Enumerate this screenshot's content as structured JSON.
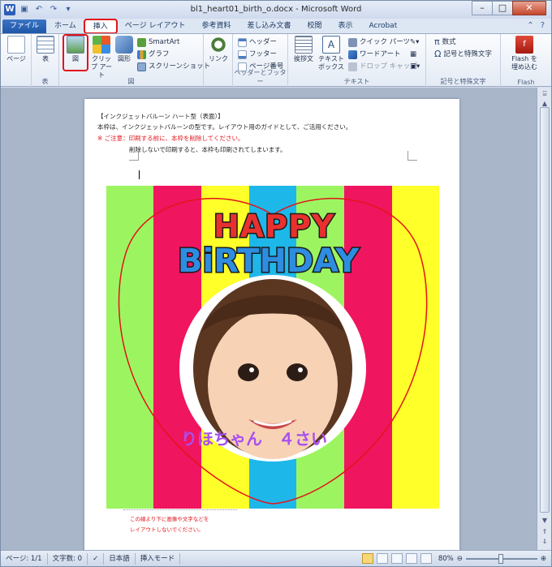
{
  "window": {
    "title": "bl1_heart01_birth_o.docx - Microsoft Word",
    "app_icon_letter": "W"
  },
  "quick_access": [
    "save-icon",
    "undo-icon",
    "redo-icon",
    "customize-icon"
  ],
  "tabs": [
    {
      "label": "ファイル"
    },
    {
      "label": "ホーム"
    },
    {
      "label": "挿入"
    },
    {
      "label": "ページ レイアウト"
    },
    {
      "label": "参考資料"
    },
    {
      "label": "差し込み文書"
    },
    {
      "label": "校閲"
    },
    {
      "label": "表示"
    },
    {
      "label": "Acrobat"
    }
  ],
  "ribbon": {
    "pages": {
      "label": "ページ"
    },
    "tables": {
      "button": "表",
      "group": "表"
    },
    "illustrations": {
      "picture": "図",
      "clipart": "クリップ アート",
      "shapes": "図形",
      "smartart": "SmartArt",
      "chart": "グラフ",
      "screenshot": "スクリーンショット",
      "group": "図"
    },
    "links": {
      "button": "リンク"
    },
    "header_footer": {
      "header": "ヘッダー",
      "footer": "フッター",
      "page_number": "ページ番号",
      "group": "ヘッダーとフッター"
    },
    "text": {
      "textbox": "挨拶文",
      "textbox2": "テキスト ボックス",
      "quickparts": "クイック パーツ",
      "wordart": "ワードアート",
      "dropcap": "ドロップ キャップ",
      "group": "テキスト"
    },
    "symbols": {
      "equation": "数式",
      "symbol": "記号と特殊文字",
      "group": "記号と特殊文字"
    },
    "flash": {
      "button_line1": "Flash を",
      "button_line2": "埋め込む",
      "group": "Flash"
    }
  },
  "document": {
    "lines": [
      "【インクジェットバルーン ハート型（表面）】",
      "本枠は、インクジェットバルーンの型です。レイアウト用のガイドとして、ご活用ください。",
      "※ ご注意：印刷する前に、本枠を削除してください。",
      "削除しないで印刷すると、本枠も印刷されてしまいます。"
    ],
    "artwork": {
      "stripe_colors": [
        "#9cf560",
        "#f0155f",
        "#ffff2a",
        "#1eb7e9",
        "#9cf560",
        "#f0155f",
        "#ffff2a"
      ],
      "title_top": "HAPPY",
      "title_bottom": "BiRTHDAY",
      "caption": "りほちゃん　４さい",
      "outline_color": "#e2141b"
    },
    "notes": [
      "この線より下に画像や文字などを",
      "レイアウトしないでください。"
    ]
  },
  "status": {
    "page": "ページ: 1/1",
    "words": "文字数: 0",
    "language": "日本語",
    "mode": "挿入モード",
    "zoom": "80%"
  }
}
